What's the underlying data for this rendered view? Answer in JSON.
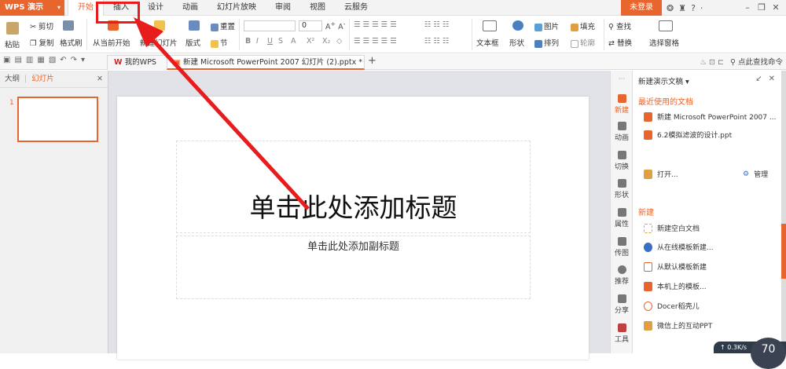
{
  "app": {
    "name": "WPS 演示",
    "caret": "▾"
  },
  "menu": {
    "tabs": [
      "开始",
      "插入",
      "设计",
      "动画",
      "幻灯片放映",
      "审阅",
      "视图",
      "云服务"
    ],
    "active": "开始"
  },
  "topbar": {
    "login": "未登录",
    "help": "?",
    "icons": [
      "skin-icon",
      "shirt-icon",
      "help-icon",
      "more-icon"
    ]
  },
  "ribbon": {
    "paste": "粘贴",
    "cut": "剪切",
    "copy": "复制",
    "format_painter": "格式刷",
    "from_current": "从当前开始",
    "new_slide": "新建幻灯片",
    "layout": "版式",
    "section": "节",
    "reset": "重置",
    "font_size": "0",
    "bold": "B",
    "italic": "I",
    "underline": "U",
    "strike": "S",
    "font_color": "A",
    "superscript": "X²",
    "subscript": "X₂",
    "clear": "◇",
    "text_box": "文本框",
    "shape": "形状",
    "picture": "图片",
    "fill": "填充",
    "arrange": "排列",
    "outline": "轮廓",
    "find": "查找",
    "replace": "替换",
    "select_pane": "选择窗格"
  },
  "tabs": {
    "my_wps": "我的WPS",
    "document": "新建 Microsoft PowerPoint 2007 幻灯片 (2).pptx *",
    "add": "+",
    "search_cmd": "点此查找命令"
  },
  "left_pane": {
    "outline": "大纲",
    "slides": "幻灯片",
    "slide_number": "1"
  },
  "slide": {
    "title_placeholder": "单击此处添加标题",
    "subtitle_placeholder": "单击此处添加副标题"
  },
  "right_bar": [
    "新建",
    "动画",
    "切换",
    "形状",
    "属性",
    "传图",
    "推荐",
    "分享",
    "工具"
  ],
  "right_panel": {
    "header": "新建演示文稿",
    "recent_title": "最近使用的文档",
    "recent": [
      "新建 Microsoft PowerPoint 2007 ...",
      "6.2模拟滤波的设计.ppt"
    ],
    "open": "打开...",
    "manage": "管理",
    "new_title": "新建",
    "new_items": [
      "新建空白文档",
      "从在线模板新建...",
      "从默认模板新建",
      "本机上的模板...",
      "Docer稻壳儿",
      "微信上的互动PPT"
    ]
  },
  "status": {
    "speed": "0.3K/s",
    "gauge": "70"
  },
  "colors": {
    "accent": "#e8652d",
    "annotation": "#e81c1c"
  }
}
